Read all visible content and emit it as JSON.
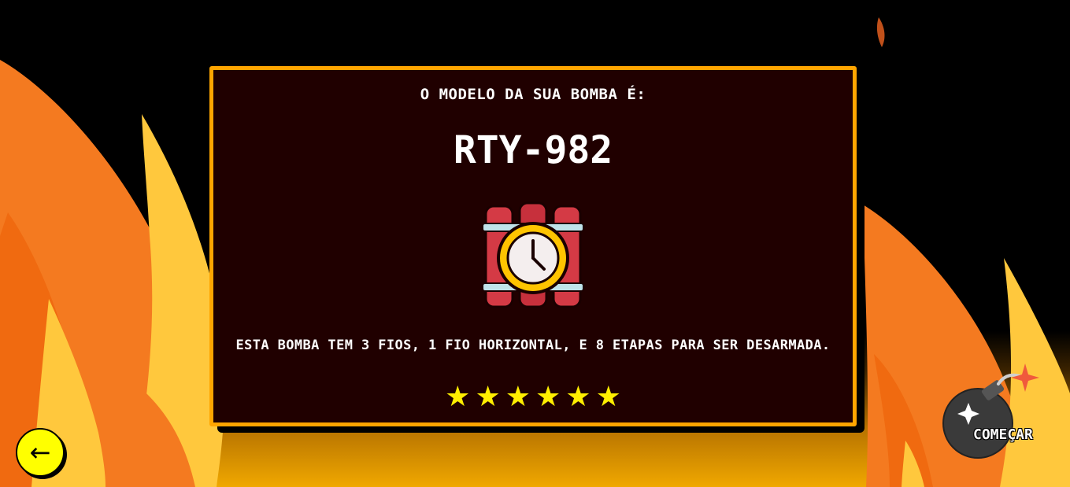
{
  "panel": {
    "heading": "O MODELO DA SUA BOMBA É:",
    "model": "RTY-982",
    "description": "ESTA BOMBA TEM 3 FIOS, 1 FIO HORIZONTAL, E 8 ETAPAS PARA SER DESARMADA.",
    "difficulty_stars": 6,
    "bomb_icon": "dynamite-clock-icon"
  },
  "nav": {
    "back_label": "←",
    "start_label": "COMEÇAR",
    "start_icon": "bomb-icon"
  },
  "colors": {
    "panel_bg": "#200000",
    "panel_border": "#ffa500",
    "star": "#ffee00",
    "back_button": "#ffff00",
    "flame_outer": "#f47a20",
    "flame_inner": "#ffc83d"
  }
}
